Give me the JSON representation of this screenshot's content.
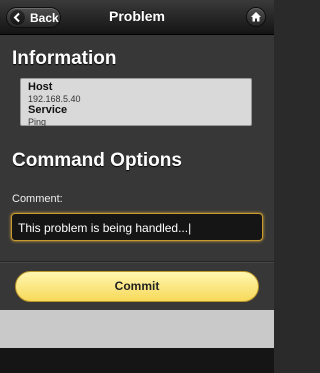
{
  "header": {
    "back_label": "Back",
    "title": "Problem"
  },
  "information": {
    "heading": "Information",
    "host_label": "Host",
    "host_value": "192.168.5.40",
    "service_label": "Service",
    "service_value": "Ping"
  },
  "command_options": {
    "heading": "Command Options",
    "comment_label": "Comment:",
    "comment_value": "This problem is being handled...|",
    "commit_label": "Commit"
  },
  "colors": {
    "accent_button": "#f7d95a",
    "input_focus_border": "#c99a2e",
    "info_box_bg": "#d9d9d9"
  },
  "icons": {
    "back": "chevron-left-icon",
    "home": "home-icon"
  }
}
